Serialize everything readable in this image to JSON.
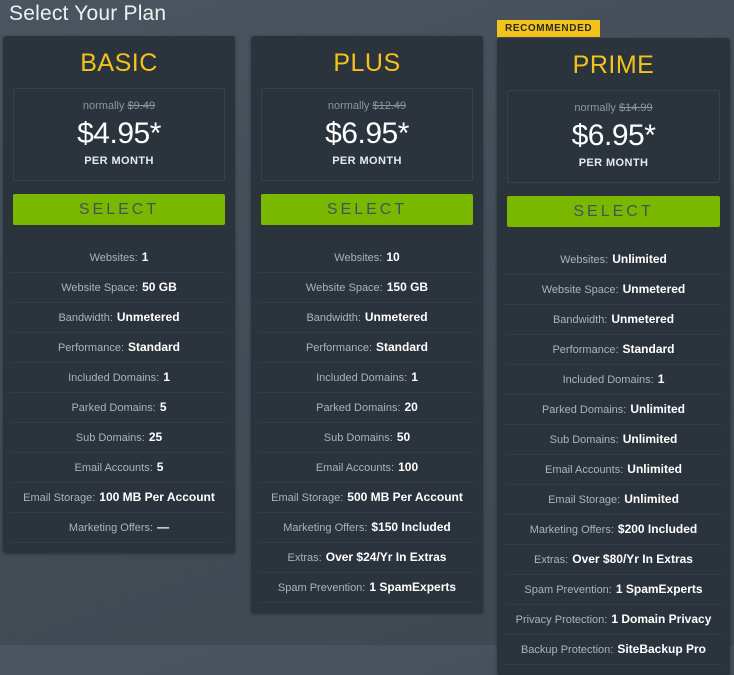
{
  "page": {
    "title": "Select Your Plan"
  },
  "labels": {
    "normally_prefix": "normally",
    "per_month": "PER MONTH",
    "select_label": "SELECT",
    "recommended_badge": "RECOMMENDED"
  },
  "colors": {
    "accent_yellow": "#f3c31a",
    "button_green": "#7ab800",
    "card_background": "#2b333c",
    "page_background": "#454f59"
  },
  "plans": [
    {
      "id": "basic",
      "name": "BASIC",
      "recommended": false,
      "original_price": "$9.49",
      "price": "$4.95*",
      "features": [
        {
          "label": "Websites:",
          "value": "1"
        },
        {
          "label": "Website Space:",
          "value": "50 GB"
        },
        {
          "label": "Bandwidth:",
          "value": "Unmetered"
        },
        {
          "label": "Performance:",
          "value": "Standard"
        },
        {
          "label": "Included Domains:",
          "value": "1"
        },
        {
          "label": "Parked Domains:",
          "value": "5"
        },
        {
          "label": "Sub Domains:",
          "value": "25"
        },
        {
          "label": "Email Accounts:",
          "value": "5"
        },
        {
          "label": "Email Storage:",
          "value": "100 MB Per Account"
        },
        {
          "label": "Marketing Offers:",
          "value": "—"
        }
      ]
    },
    {
      "id": "plus",
      "name": "PLUS",
      "recommended": false,
      "original_price": "$12.49",
      "price": "$6.95*",
      "features": [
        {
          "label": "Websites:",
          "value": "10"
        },
        {
          "label": "Website Space:",
          "value": "150 GB"
        },
        {
          "label": "Bandwidth:",
          "value": "Unmetered"
        },
        {
          "label": "Performance:",
          "value": "Standard"
        },
        {
          "label": "Included Domains:",
          "value": "1"
        },
        {
          "label": "Parked Domains:",
          "value": "20"
        },
        {
          "label": "Sub Domains:",
          "value": "50"
        },
        {
          "label": "Email Accounts:",
          "value": "100"
        },
        {
          "label": "Email Storage:",
          "value": "500 MB Per Account"
        },
        {
          "label": "Marketing Offers:",
          "value": "$150 Included"
        },
        {
          "label": "Extras:",
          "value": "Over $24/Yr In Extras"
        },
        {
          "label": "Spam Prevention:",
          "value": "1 SpamExperts"
        }
      ]
    },
    {
      "id": "prime",
      "name": "PRIME",
      "recommended": true,
      "original_price": "$14.99",
      "price": "$6.95*",
      "features": [
        {
          "label": "Websites:",
          "value": "Unlimited"
        },
        {
          "label": "Website Space:",
          "value": "Unmetered"
        },
        {
          "label": "Bandwidth:",
          "value": "Unmetered"
        },
        {
          "label": "Performance:",
          "value": "Standard"
        },
        {
          "label": "Included Domains:",
          "value": "1"
        },
        {
          "label": "Parked Domains:",
          "value": "Unlimited"
        },
        {
          "label": "Sub Domains:",
          "value": "Unlimited"
        },
        {
          "label": "Email Accounts:",
          "value": "Unlimited"
        },
        {
          "label": "Email Storage:",
          "value": "Unlimited"
        },
        {
          "label": "Marketing Offers:",
          "value": "$200 Included"
        },
        {
          "label": "Extras:",
          "value": "Over $80/Yr In Extras"
        },
        {
          "label": "Spam Prevention:",
          "value": "1 SpamExperts"
        },
        {
          "label": "Privacy Protection:",
          "value": "1 Domain Privacy"
        },
        {
          "label": "Backup Protection:",
          "value": "SiteBackup Pro"
        }
      ]
    }
  ]
}
